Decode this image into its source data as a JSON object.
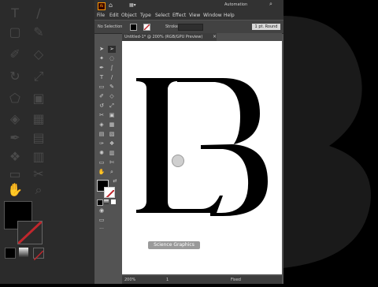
{
  "app": {
    "logo": "Ai",
    "workspace": "Automation",
    "menu": [
      "File",
      "Edit",
      "Object",
      "Type",
      "Select",
      "Effect",
      "View",
      "Window",
      "Help"
    ]
  },
  "control_bar": {
    "selection": "No Selection",
    "stroke_label": "Stroke:",
    "stroke_value": "1 pt. Round"
  },
  "document": {
    "tab_title": "Untitled-1* @ 200% (RGB/GPU Preview)",
    "artwork_glyphs": "LB"
  },
  "status_bar": {
    "zoom": "200%",
    "page": "1",
    "state": "Fixed"
  },
  "watermark": "Science Graphics",
  "colors": {
    "panel": "#535353",
    "chrome": "#323232",
    "artboard": "#ffffff",
    "fill": "#000000"
  }
}
